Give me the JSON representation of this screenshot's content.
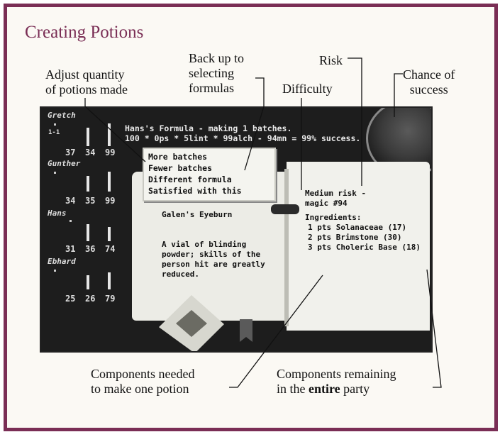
{
  "title": "Creating Potions",
  "callouts": {
    "adjust_quantity": [
      "Adjust quantity",
      "of potions made"
    ],
    "back_up": [
      "Back up to",
      "selecting",
      "formulas"
    ],
    "difficulty": "Difficulty",
    "risk": "Risk",
    "chance": [
      "Chance of",
      "success"
    ],
    "components_needed": [
      "Components needed",
      "to make one potion"
    ],
    "components_remaining": [
      "Components remaining",
      "in the",
      "entire",
      "party"
    ]
  },
  "game": {
    "status_line1": "Hans's Formula - making 1 batches.",
    "status_line2": "100 * 0ps * 5lint * 99alch - 94mn = 99% success.",
    "party": [
      {
        "name": "Gretch",
        "tag": "1-1",
        "stats": [
          "37",
          "34",
          "99"
        ]
      },
      {
        "name": "Gunther",
        "tag": "",
        "stats": [
          "34",
          "35",
          "99"
        ]
      },
      {
        "name": "Hans",
        "tag": "",
        "stats": [
          "31",
          "36",
          "74"
        ]
      },
      {
        "name": "Ebhard",
        "tag": "",
        "stats": [
          "25",
          "26",
          "79"
        ]
      }
    ],
    "menu": [
      "More batches",
      "Fewer batches",
      "Different formula",
      "Satisfied with this"
    ],
    "potion_name": "Galen's Eyeburn",
    "description": [
      "A vial of blinding",
      "powder; skills of the",
      "person hit are greatly",
      "reduced."
    ],
    "risk_text": [
      "Medium risk -",
      "magic #94"
    ],
    "ingredients_header": "Ingredients:",
    "ingredients": [
      "1 pts Solanaceae (17)",
      "2 pts Brimstone (30)",
      "3 pts Choleric Base (18)"
    ]
  }
}
